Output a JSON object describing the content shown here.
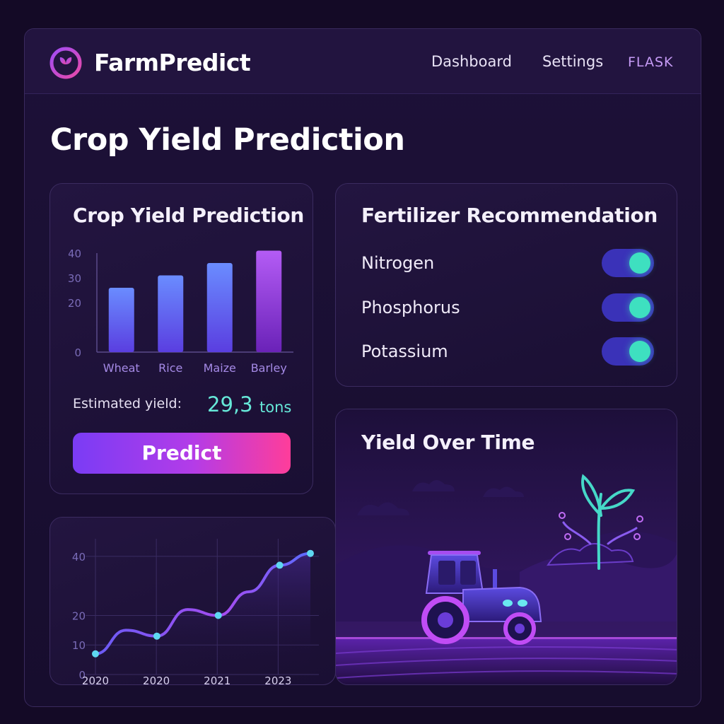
{
  "header": {
    "brand": "FarmPredict",
    "nav": [
      {
        "label": "Dashboard"
      },
      {
        "label": "Settings"
      },
      {
        "label": "FLASK"
      }
    ]
  },
  "page_title": "Crop Yield Prediction",
  "crop_card": {
    "title": "Crop Yield Prediction",
    "estimated_label": "Estimated yield:",
    "estimated_value": "29,3",
    "estimated_unit": "tons",
    "predict_label": "Predict"
  },
  "fertilizer": {
    "title": "Fertilizer Recommendation",
    "items": [
      {
        "label": "Nitrogen",
        "enabled": true
      },
      {
        "label": "Phosphorus",
        "enabled": true
      },
      {
        "label": "Potassium",
        "enabled": true
      }
    ]
  },
  "yield_time": {
    "title": "Yield Over Time"
  },
  "colors": {
    "accent": "#7a3cf5",
    "teal": "#66e8d8",
    "pink": "#ff3d9a",
    "bar": "#6a6cf5",
    "bar_highlight": "#a34ee8"
  },
  "chart_data": [
    {
      "type": "bar",
      "categories": [
        "Wheat",
        "Rice",
        "Maize",
        "Barley"
      ],
      "values": [
        26,
        31,
        36,
        41
      ],
      "ylim": [
        0,
        40
      ],
      "yticks": [
        0,
        20,
        30,
        40
      ],
      "grid": false
    },
    {
      "type": "line",
      "x_labels": [
        "2020",
        "2020",
        "2021",
        "2023"
      ],
      "x": [
        0,
        1,
        2,
        3,
        4,
        5,
        6,
        7
      ],
      "values": [
        7,
        15,
        13,
        22,
        20,
        28,
        37,
        41
      ],
      "markers": [
        0,
        2,
        4,
        6,
        7
      ],
      "ylim": [
        0,
        45
      ],
      "yticks": [
        0,
        10,
        20,
        40
      ],
      "grid": true
    }
  ]
}
